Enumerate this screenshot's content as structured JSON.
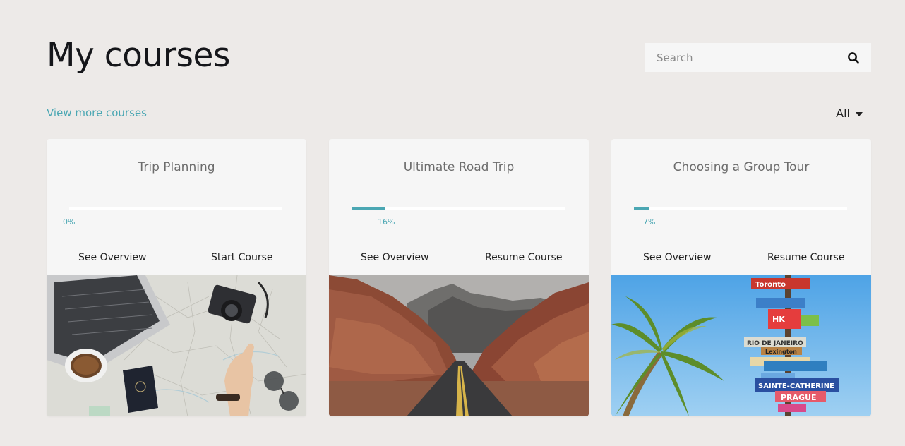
{
  "header": {
    "title": "My courses",
    "search_placeholder": "Search",
    "view_more": "View more courses",
    "filter_value": "All"
  },
  "colors": {
    "accent": "#4ba7b3",
    "background": "#edeae8",
    "card": "#f6f6f6"
  },
  "courses": [
    {
      "title": "Trip Planning",
      "progress": 0,
      "progress_label": "0%",
      "overview_label": "See Overview",
      "action_label": "Start Course",
      "image": "travel-desk-photo"
    },
    {
      "title": "Ultimate Road Trip",
      "progress": 16,
      "progress_label": "16%",
      "overview_label": "See Overview",
      "action_label": "Resume Course",
      "image": "desert-road-photo"
    },
    {
      "title": "Choosing a Group Tour",
      "progress": 7,
      "progress_label": "7%",
      "overview_label": "See Overview",
      "action_label": "Resume Course",
      "image": "signpost-palm-photo"
    }
  ]
}
